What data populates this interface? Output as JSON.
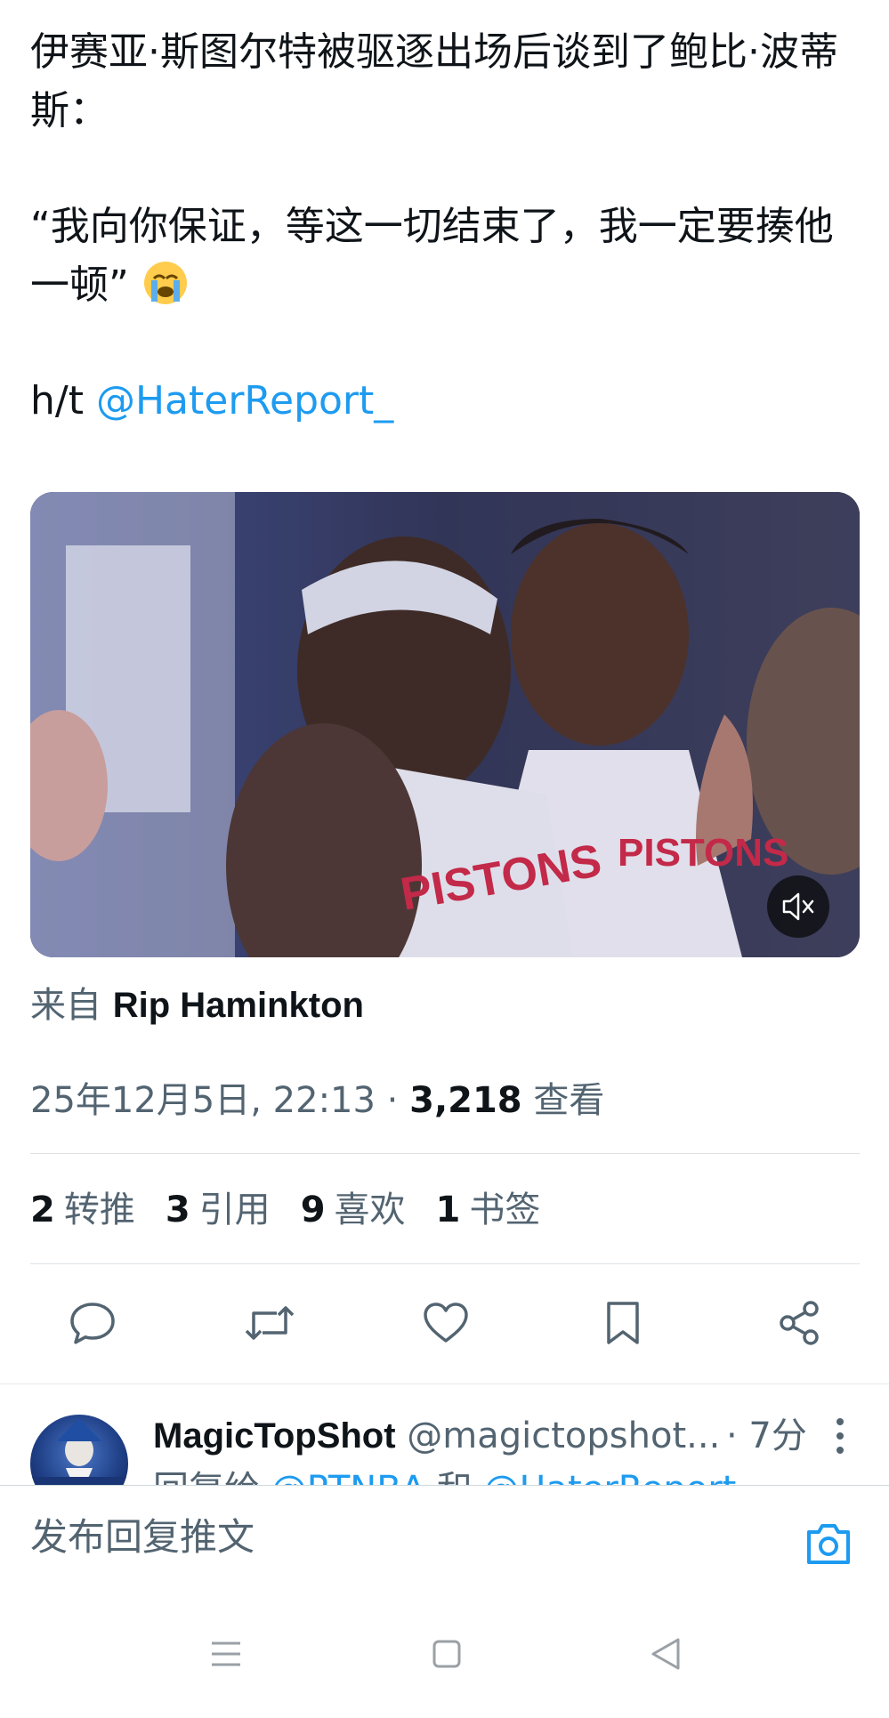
{
  "tweet": {
    "line1": "伊赛亚·斯图尔特被驱逐出场后谈到了鲍比·波蒂斯：",
    "line2_quote": "“我向你保证，等这一切结束了，我一定要揍他一顿”",
    "emoji": "loudly-crying-face-emoji",
    "ht_prefix": "h/t ",
    "ht_mention": "@HaterReport_"
  },
  "media": {
    "jersey_text_1": "PISTONS",
    "jersey_text_2": "PISTONS",
    "mute_icon": "muted-speaker-icon"
  },
  "source": {
    "prefix": "来自 ",
    "name": "Rip Haminkton"
  },
  "meta": {
    "datetime": "25年12月5日, 22:13",
    "separator": " · ",
    "views_count": "3,218",
    "views_label": " 查看"
  },
  "stats": [
    {
      "count": "2",
      "label": "转推"
    },
    {
      "count": "3",
      "label": "引用"
    },
    {
      "count": "9",
      "label": "喜欢"
    },
    {
      "count": "1",
      "label": "书签"
    }
  ],
  "actions": [
    "reply-icon",
    "retweet-icon",
    "like-icon",
    "bookmark-icon",
    "share-icon"
  ],
  "reply": {
    "name": "MagicTopShot",
    "handle": " @magictopshot...",
    "time": "· 7分",
    "reply_to_prefix": "回复给 ",
    "reply_to_1": "@PTNBA",
    "reply_to_and": " 和 ",
    "reply_to_2": "@HaterReport_"
  },
  "compose": {
    "placeholder": "发布回复推文"
  },
  "colors": {
    "accent": "#1d9bf0",
    "text": "#0f1419",
    "secondary": "#536471"
  }
}
